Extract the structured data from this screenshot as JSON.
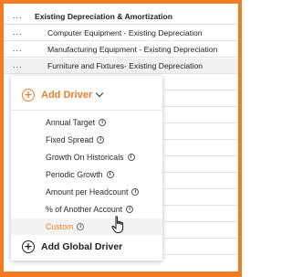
{
  "rows": [
    {
      "dots": "...",
      "label": "Existing Depreciation & Amortization"
    },
    {
      "dots": "...",
      "label": "Computer Equipment - Existing Depreciation"
    },
    {
      "dots": "...",
      "label": "Manufacturing Equipment - Existing Depreciation"
    },
    {
      "dots": "...",
      "label": "Furniture and Fixtures- Existing Depreciation"
    }
  ],
  "dropdown": {
    "add_driver_label": "Add Driver",
    "options": [
      {
        "label": "Annual Target"
      },
      {
        "label": "Fixed Spread"
      },
      {
        "label": "Growth On Historicals"
      },
      {
        "label": "Periodic Growth"
      },
      {
        "label": "Amount per Headcount"
      },
      {
        "label": "% of Another Account"
      },
      {
        "label": "Custom"
      }
    ],
    "hovered_option": "Custom",
    "add_global_label": "Add Global Driver"
  },
  "icons": {
    "plus": "+",
    "info": "i"
  },
  "colors": {
    "accent": "#f47b20",
    "text": "#1e1e1e",
    "row_highlight": "#f1f1f1"
  }
}
